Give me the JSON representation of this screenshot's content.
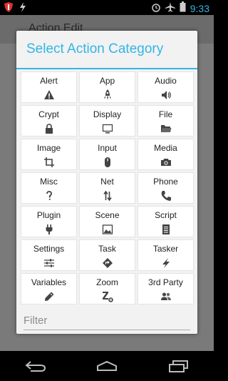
{
  "status": {
    "time": "9:33",
    "icons_left": [
      "shield-icon",
      "lightning-icon"
    ],
    "icons_right": [
      "alarm-icon",
      "airplane-icon",
      "battery-icon"
    ]
  },
  "background_app": {
    "title": "Action Edit"
  },
  "dialog": {
    "title": "Select Action Category",
    "accent_color": "#33b5e5",
    "categories": [
      {
        "label": "Alert",
        "icon": "warning-icon"
      },
      {
        "label": "App",
        "icon": "rocket-icon"
      },
      {
        "label": "Audio",
        "icon": "speaker-icon"
      },
      {
        "label": "Crypt",
        "icon": "lock-icon"
      },
      {
        "label": "Display",
        "icon": "monitor-icon"
      },
      {
        "label": "File",
        "icon": "folder-icon"
      },
      {
        "label": "Image",
        "icon": "crop-icon"
      },
      {
        "label": "Input",
        "icon": "mouse-icon"
      },
      {
        "label": "Media",
        "icon": "camera-icon"
      },
      {
        "label": "Misc",
        "icon": "question-icon"
      },
      {
        "label": "Net",
        "icon": "transfer-arrows-icon"
      },
      {
        "label": "Phone",
        "icon": "phone-icon"
      },
      {
        "label": "Plugin",
        "icon": "plug-icon"
      },
      {
        "label": "Scene",
        "icon": "picture-icon"
      },
      {
        "label": "Script",
        "icon": "document-icon"
      },
      {
        "label": "Settings",
        "icon": "sliders-icon"
      },
      {
        "label": "Task",
        "icon": "diamond-arrow-icon"
      },
      {
        "label": "Tasker",
        "icon": "lightning-icon"
      },
      {
        "label": "Variables",
        "icon": "pencil-icon"
      },
      {
        "label": "Zoom",
        "icon": "zoom-gear-icon"
      },
      {
        "label": "3rd Party",
        "icon": "people-icon"
      }
    ],
    "filter_placeholder": "Filter"
  },
  "nav": {
    "buttons": [
      "back-icon",
      "home-icon",
      "recent-apps-icon"
    ]
  }
}
